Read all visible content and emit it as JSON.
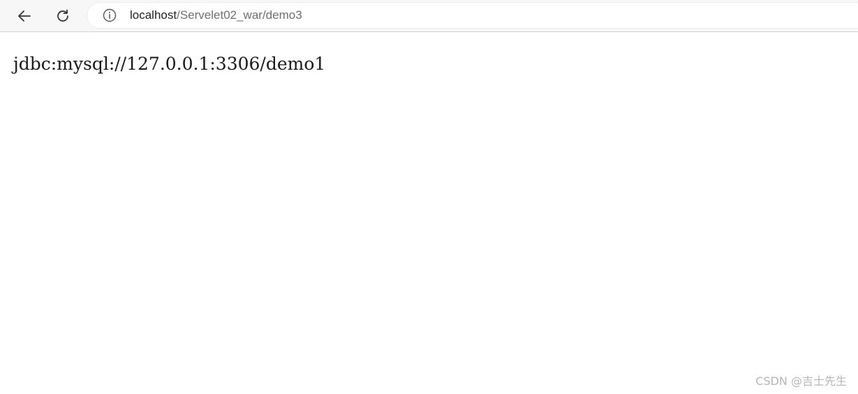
{
  "browser": {
    "url_host": "localhost",
    "url_path": "/Servelet02_war/demo3",
    "icons": {
      "back": "arrow-left-icon",
      "reload": "reload-icon",
      "info": "info-circle-icon"
    }
  },
  "page": {
    "body_text": "jdbc:mysql://127.0.0.1:3306/demo1"
  },
  "watermark": {
    "text": "CSDN @吉士先生"
  }
}
